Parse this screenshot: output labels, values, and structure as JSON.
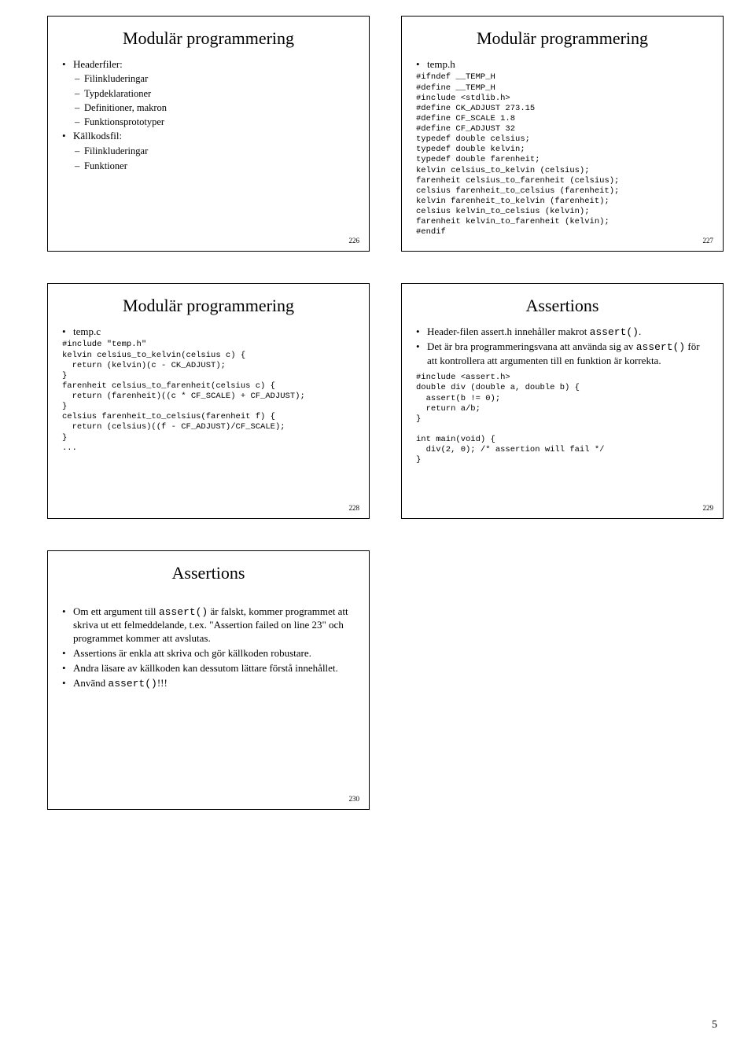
{
  "slide1": {
    "title": "Modulär programmering",
    "b1": "Headerfiler:",
    "d1": "Filinkluderingar",
    "d2": "Typdeklarationer",
    "d3": "Definitioner, makron",
    "d4": "Funktionsprototyper",
    "b2": "Källkodsfil:",
    "d5": "Filinkluderingar",
    "d6": "Funktioner",
    "num": "226"
  },
  "slide2": {
    "title": "Modulär programmering",
    "b1": "temp.h",
    "code": "#ifndef __TEMP_H\n#define __TEMP_H\n#include <stdlib.h>\n#define CK_ADJUST 273.15\n#define CF_SCALE 1.8\n#define CF_ADJUST 32\ntypedef double celsius;\ntypedef double kelvin;\ntypedef double farenheit;\nkelvin celsius_to_kelvin (celsius);\nfarenheit celsius_to_farenheit (celsius);\ncelsius farenheit_to_celsius (farenheit);\nkelvin farenheit_to_kelvin (farenheit);\ncelsius kelvin_to_celsius (kelvin);\nfarenheit kelvin_to_farenheit (kelvin);\n#endif",
    "num": "227"
  },
  "slide3": {
    "title": "Modulär programmering",
    "b1": "temp.c",
    "code": "#include \"temp.h\"\nkelvin celsius_to_kelvin(celsius c) {\n  return (kelvin)(c - CK_ADJUST);\n}\nfarenheit celsius_to_farenheit(celsius c) {\n  return (farenheit)((c * CF_SCALE) + CF_ADJUST);\n}\ncelsius farenheit_to_celsius(farenheit f) {\n  return (celsius)((f - CF_ADJUST)/CF_SCALE);\n}\n...",
    "num": "228"
  },
  "slide4": {
    "title": "Assertions",
    "b1a": "Header-filen assert.h innehåller makrot ",
    "b1b": "assert()",
    "b1c": ".",
    "b2a": "Det är bra programmeringsvana att använda sig av ",
    "b2b": "assert()",
    "b2c": " för att kontrollera att argumenten till en funktion är korrekta.",
    "code": "#include <assert.h>\ndouble div (double a, double b) {\n  assert(b != 0);\n  return a/b;\n}\n\nint main(void) {\n  div(2, 0); /* assertion will fail */\n}",
    "num": "229"
  },
  "slide5": {
    "title": "Assertions",
    "b1a": "Om ett argument till ",
    "b1b": "assert()",
    "b1c": " är falskt, kommer programmet att skriva ut ett felmeddelande, t.ex. \"Assertion failed on line 23\" och programmet kommer att avslutas.",
    "b2": "Assertions är enkla att skriva och gör källkoden robustare.",
    "b3": "Andra läsare av källkoden kan dessutom lättare förstå innehållet.",
    "b4a": "Använd ",
    "b4b": "assert()",
    "b4c": "!!!",
    "num": "230"
  },
  "pagenum": "5"
}
